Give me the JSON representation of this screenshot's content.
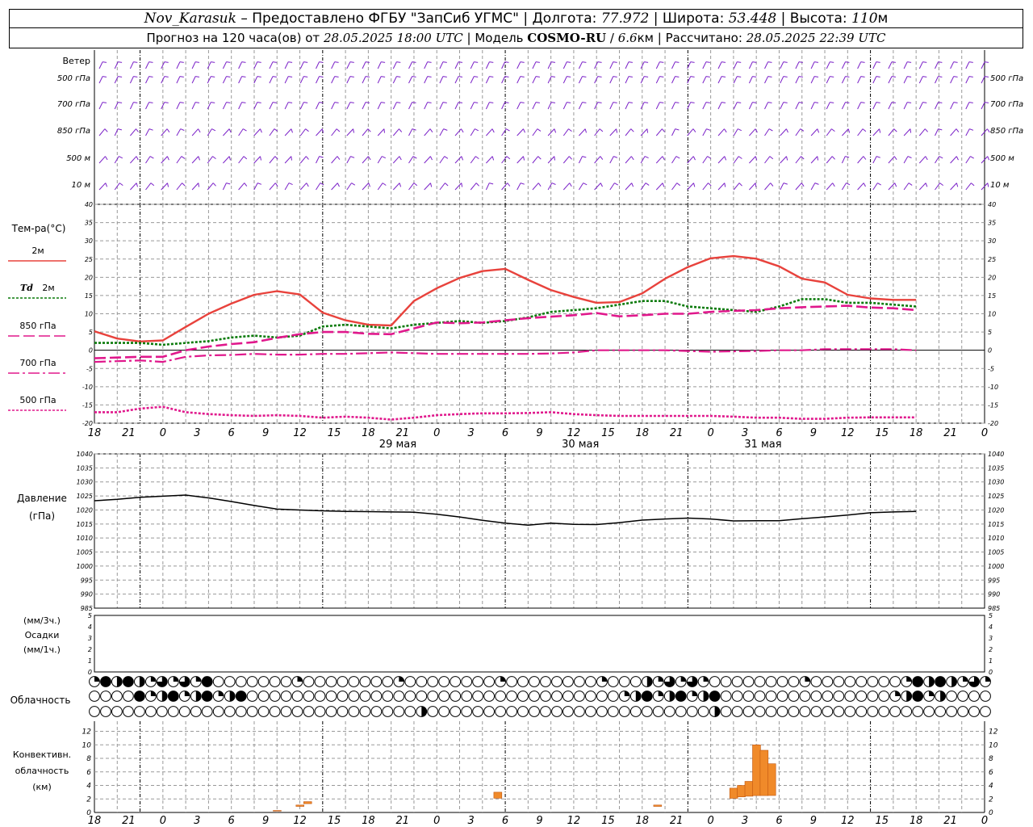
{
  "header": {
    "station": "Nov_Karasuk",
    "provider": "Предоставлено ФГБУ \"ЗапСиб УГМС\"",
    "lon_label": "Долгота:",
    "lon": "77.972",
    "lat_label": "Широта:",
    "lat": "53.448",
    "alt_label": "Высота:",
    "alt": "110",
    "alt_unit": "м",
    "forecast_label": "Прогноз на 120 часа(ов) от",
    "forecast_time": "28.05.2025 18:00 UTC",
    "model_label": "Модель",
    "model_name": "COSMO-RU",
    "model_res": "6.6",
    "model_res_unit": "км",
    "calc_label": "Рассчитано:",
    "calc_time": "28.05.2025 22:39 UTC"
  },
  "colors": {
    "wind": "#7b22c8",
    "temp2m": "#e8423c",
    "td2m": "#0a7a0a",
    "magenta": "#e0188c",
    "pressure": "#000000",
    "convective": "#f08a2a"
  },
  "chart_data": [
    {
      "type": "line",
      "title": "Ветер",
      "levels": [
        "500 гПа",
        "700 гПа",
        "850 гПа",
        "500 м",
        "10 м"
      ],
      "glyph": "wind-barb"
    },
    {
      "type": "line",
      "title": "Тем-ра(°C)",
      "ylim": [
        -20,
        40
      ],
      "yticks": [
        -20,
        -15,
        -10,
        -5,
        0,
        5,
        10,
        15,
        20,
        25,
        30,
        35,
        40
      ],
      "hours": [
        0,
        3,
        6,
        9,
        12,
        15,
        18,
        21,
        24,
        27,
        30,
        33,
        36,
        39,
        42,
        45,
        48,
        51,
        54,
        57,
        60,
        63,
        66,
        69,
        72,
        75,
        78,
        81,
        84,
        87,
        90,
        93,
        96,
        99,
        102,
        105,
        108,
        111,
        114,
        117,
        120
      ],
      "series": [
        {
          "name": "2м",
          "style": "solid",
          "values": [
            5.2,
            3.2,
            2.4,
            2.7,
            6.4,
            10,
            12.8,
            15.2,
            16.2,
            15.3,
            10.3,
            8.2,
            7,
            6.8,
            13.5,
            17,
            19.8,
            21.7,
            22.3,
            19.3,
            16.5,
            14.6,
            13,
            13.2,
            15.6,
            19.6,
            22.8,
            25.2,
            25.8,
            25.1,
            23,
            19.6,
            18.6,
            15.2,
            14.2,
            13.8,
            13.8,
            null,
            null,
            null,
            null
          ]
        },
        {
          "name": "Td 2м",
          "style": "dotted",
          "values": [
            2,
            2,
            2,
            1.5,
            2,
            2.5,
            3.5,
            4,
            3.5,
            4,
            6.5,
            7,
            6.5,
            6,
            7,
            7.5,
            8,
            7.5,
            8,
            9,
            10.5,
            11,
            11.5,
            12.5,
            13.5,
            13.5,
            12,
            11.5,
            11,
            10.5,
            12,
            14,
            14,
            13,
            13,
            12.5,
            12,
            null,
            null,
            null,
            null
          ]
        },
        {
          "name": "850 гПа",
          "style": "dashed",
          "values": [
            -2.2,
            -2,
            -1.8,
            -1.8,
            0,
            1,
            1.7,
            2.2,
            3.4,
            4.4,
            5,
            5,
            4.5,
            4.4,
            6,
            7.6,
            7.4,
            7.6,
            8.2,
            8.8,
            9.2,
            9.6,
            10.2,
            9.3,
            9.6,
            10,
            10,
            10.5,
            10.8,
            11,
            11.5,
            11.8,
            12,
            12.2,
            11.7,
            11.5,
            11,
            null,
            null,
            null,
            null
          ]
        },
        {
          "name": "700 гПа",
          "style": "dashdot",
          "values": [
            -3.2,
            -3,
            -2.8,
            -3.2,
            -1.8,
            -1.4,
            -1.3,
            -1,
            -1.2,
            -1.2,
            -1,
            -1,
            -0.8,
            -0.6,
            -0.8,
            -1,
            -1,
            -1,
            -1,
            -1,
            -0.9,
            -0.6,
            0,
            0,
            0,
            0,
            -0.2,
            -0.4,
            -0.3,
            -0.2,
            0,
            0,
            0.3,
            0.3,
            0.3,
            0.3,
            0,
            null,
            null,
            null,
            null
          ]
        },
        {
          "name": "500 гПа",
          "style": "dotted",
          "values": [
            -17,
            -17,
            -16,
            -15.5,
            -17,
            -17.5,
            -17.8,
            -18,
            -17.8,
            -18,
            -18.5,
            -18.2,
            -18.5,
            -19,
            -18.5,
            -17.8,
            -17.5,
            -17.3,
            -17.3,
            -17.2,
            -17,
            -17.5,
            -17.8,
            -18,
            -18,
            -18,
            -18,
            -18,
            -18.2,
            -18.5,
            -18.5,
            -18.8,
            -18.8,
            -18.5,
            -18.4,
            -18.4,
            -18.4,
            null,
            null,
            null,
            null
          ]
        }
      ]
    },
    {
      "type": "line",
      "title": "Давление",
      "unit": "(гПа)",
      "ylim": [
        985,
        1040
      ],
      "yticks": [
        985,
        990,
        995,
        1000,
        1005,
        1010,
        1015,
        1020,
        1025,
        1030,
        1035,
        1040
      ],
      "hours": [
        0,
        3,
        6,
        9,
        12,
        15,
        18,
        21,
        24,
        27,
        30,
        33,
        36,
        39,
        42,
        45,
        48,
        51,
        54,
        57,
        60,
        63,
        66,
        69,
        72,
        75,
        78,
        81,
        84,
        87,
        90,
        93,
        96,
        99,
        102,
        105,
        108,
        111,
        114,
        117,
        120
      ],
      "series": [
        {
          "name": "Давление",
          "values": [
            1023.3,
            1023.8,
            1024.5,
            1024.9,
            1025.3,
            1024.3,
            1023,
            1021.6,
            1020.3,
            1020,
            1019.7,
            1019.5,
            1019.4,
            1019.3,
            1019.2,
            1018.5,
            1017.5,
            1016.3,
            1015.3,
            1014.6,
            1015.3,
            1014.9,
            1014.8,
            1015.5,
            1016.4,
            1016.8,
            1017.1,
            1016.8,
            1016.1,
            1016.2,
            1016.2,
            1016.9,
            1017.5,
            1018.2,
            1019,
            1019.3,
            1019.5,
            null,
            null,
            null,
            null
          ]
        }
      ]
    },
    {
      "type": "bar",
      "title": "Осадки",
      "units": [
        "(мм/3ч.)",
        "(мм/1ч.)"
      ],
      "ylim": [
        0,
        5
      ],
      "yticks": [
        0,
        1,
        2,
        3,
        4,
        5
      ],
      "values": []
    },
    {
      "type": "table",
      "title": "Облачность",
      "rows": 3,
      "glyph": "cloud-cover-circle"
    },
    {
      "type": "bar",
      "title": "Конвективн. облачность (км)",
      "ylim": [
        0,
        12
      ],
      "yticks": [
        0,
        2,
        4,
        6,
        8,
        10,
        12
      ],
      "bars": [
        {
          "hour": 24,
          "base": 0.2,
          "top": 0.3
        },
        {
          "hour": 27,
          "base": 0.9,
          "top": 1.1
        },
        {
          "hour": 28,
          "base": 1.3,
          "top": 1.6
        },
        {
          "hour": 53,
          "base": 2.1,
          "top": 3.0
        },
        {
          "hour": 74,
          "base": 0.9,
          "top": 1.1
        },
        {
          "hour": 84,
          "base": 2.1,
          "top": 3.6
        },
        {
          "hour": 85,
          "base": 2.3,
          "top": 4.0
        },
        {
          "hour": 86,
          "base": 2.4,
          "top": 4.6
        },
        {
          "hour": 87,
          "base": 2.5,
          "top": 10.0
        },
        {
          "hour": 88,
          "base": 2.5,
          "top": 9.2
        },
        {
          "hour": 89,
          "base": 2.5,
          "top": 7.2
        }
      ]
    }
  ],
  "axis": {
    "hour_labels": [
      "18",
      "21",
      "0",
      "3",
      "6",
      "9",
      "12",
      "15",
      "18",
      "21",
      "0",
      "3",
      "6",
      "9",
      "12",
      "15",
      "18",
      "21",
      "0",
      "3",
      "6",
      "9",
      "12",
      "15",
      "18",
      "21",
      "0"
    ],
    "day_labels": [
      "29 мая",
      "30 мая",
      "31 мая"
    ]
  },
  "legend": {
    "temp_title": "Тем-ра(°C)",
    "t2m": "2м",
    "td_sym": "Td",
    "td_lvl": "2м",
    "t850": "850 гПа",
    "t700": "700 гПа",
    "t500": "500 гПа",
    "wind_title": "Ветер",
    "pressure_title": "Давление",
    "pressure_unit": "(гПа)",
    "precip_unit3": "(мм/3ч.)",
    "precip_title": "Осадки",
    "precip_unit1": "(мм/1ч.)",
    "cloud_title": "Облачность",
    "conv1": "Конвективн.",
    "conv2": "облачность",
    "conv3": "(км)"
  }
}
